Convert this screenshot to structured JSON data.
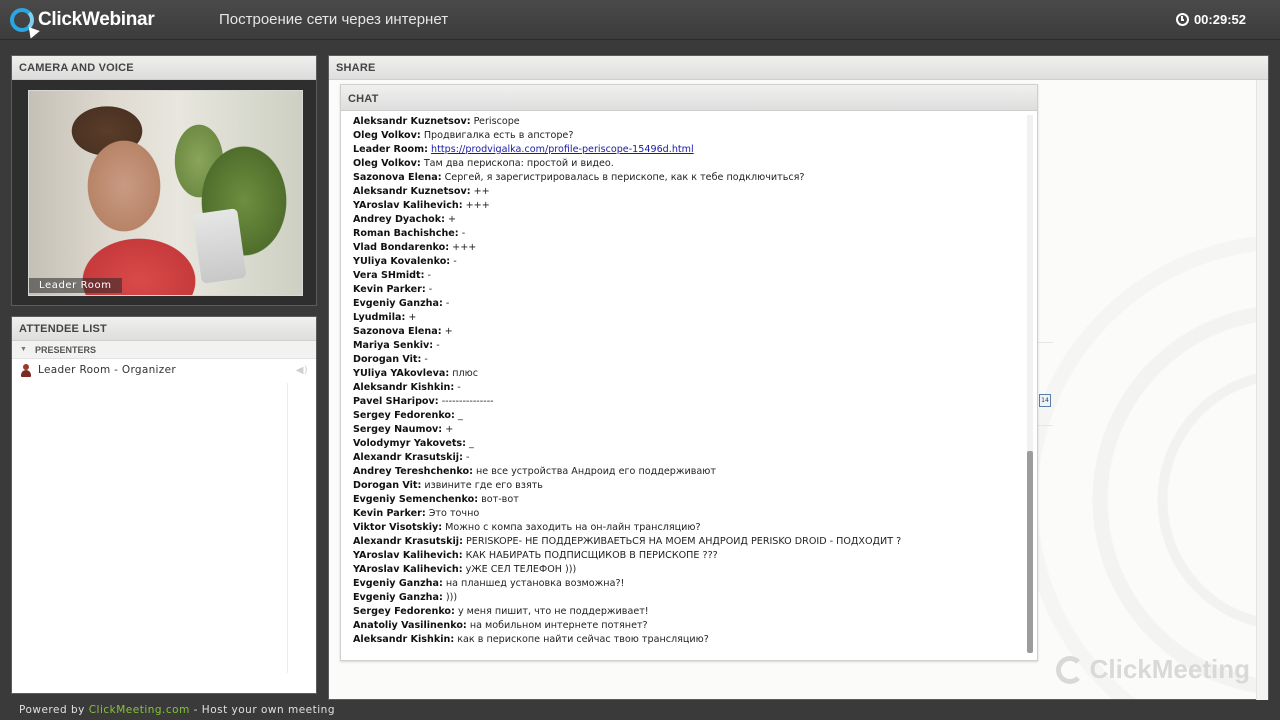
{
  "app": {
    "logo_text": "ClickWebinar",
    "meeting_title": "Построение сети через интернет",
    "timer": "00:29:52",
    "accent_color": "#2aa6e0"
  },
  "camera": {
    "header": "CAMERA AND VOICE",
    "video_label": "Leader Room"
  },
  "attendees": {
    "header": "ATTENDEE LIST",
    "group_label": "PRESENTERS",
    "items": [
      {
        "label": "Leader Room - Organizer"
      }
    ]
  },
  "share": {
    "header": "SHARE",
    "watermark": "ClickMeeting"
  },
  "chat": {
    "header": "CHAT",
    "messages": [
      {
        "author": "Aleksandr Kuznetsov:",
        "text": "Periscope"
      },
      {
        "author": "Oleg Volkov:",
        "text": "Продвигалка есть в апсторе?"
      },
      {
        "author": "Leader Room:",
        "text": "",
        "link": "https://prodvigalka.com/profile-periscope-15496d.html"
      },
      {
        "author": "Oleg Volkov:",
        "text": "Там два перископа: простой и видео."
      },
      {
        "author": "Sazonova Elena:",
        "text": "Сергей, я зарегистрировалась в перископе, как к тебе подключиться?"
      },
      {
        "author": "Aleksandr Kuznetsov:",
        "text": "++"
      },
      {
        "author": "YAroslav Kalihevich:",
        "text": "+++"
      },
      {
        "author": "Andrey Dyachok:",
        "text": "+"
      },
      {
        "author": "Roman Bachishche:",
        "text": "-"
      },
      {
        "author": "Vlad Bondarenko:",
        "text": "+++"
      },
      {
        "author": "YUliya Kovalenko:",
        "text": "-"
      },
      {
        "author": "Vera SHmidt:",
        "text": "-"
      },
      {
        "author": "Kevin Parker:",
        "text": "-"
      },
      {
        "author": "Evgeniy Ganzha:",
        "text": "-"
      },
      {
        "author": "Lyudmila:",
        "text": "+"
      },
      {
        "author": "Sazonova Elena:",
        "text": "+"
      },
      {
        "author": "Mariya Senkiv:",
        "text": "-"
      },
      {
        "author": "Dorogan Vit:",
        "text": "-"
      },
      {
        "author": "YUliya YAkovleva:",
        "text": "плюс"
      },
      {
        "author": "Aleksandr Kishkin:",
        "text": "-"
      },
      {
        "author": "Pavel SHaripov:",
        "text": "---------------"
      },
      {
        "author": "Sergey  Fedorenko:",
        "text": "_"
      },
      {
        "author": "Sergey Naumov:",
        "text": "+"
      },
      {
        "author": "Volodymyr Yakovets:",
        "text": "_"
      },
      {
        "author": "Alexandr  Krasutskij:",
        "text": "-"
      },
      {
        "author": "Andrey Tereshchenko:",
        "text": "не все устройства Андроид его поддерживают"
      },
      {
        "author": "Dorogan Vit:",
        "text": "извините где его взять"
      },
      {
        "author": "Evgeniy Semenchenko:",
        "text": "вот-вот"
      },
      {
        "author": "Kevin Parker:",
        "text": "Это точно"
      },
      {
        "author": "Viktor Visotskiy:",
        "text": "Можно с компа заходить на он-лайн трансляцию?"
      },
      {
        "author": "Alexandr  Krasutskij:",
        "text": "PERISKOPE-   НЕ ПОДДЕРЖИВАЕТЬСЯ НА МОЕМ АНДРОИД     PERISKO DROID - ПОДХОДИТ ?"
      },
      {
        "author": "YAroslav Kalihevich:",
        "text": "КАК НАБИРАТЬ ПОДПИСЩИКОВ В ПЕРИСКОПЕ ???"
      },
      {
        "author": "YAroslav Kalihevich:",
        "text": "уЖЕ СЕЛ ТЕЛЕФОН )))"
      },
      {
        "author": "Evgeniy Ganzha:",
        "text": "на планшед установка возможна?!"
      },
      {
        "author": "Evgeniy Ganzha:",
        "text": ")))"
      },
      {
        "author": "Sergey  Fedorenko:",
        "text": "у меня пишит, что не поддерживает!"
      },
      {
        "author": "Anatoliy Vasilinenko:",
        "text": "на мобильном интернете потянет?"
      },
      {
        "author": "Aleksandr Kishkin:",
        "text": "как в перископе найти сейчас твою трансляцию?"
      }
    ]
  },
  "footer": {
    "prefix": "Powered by ",
    "link": "ClickMeeting.com",
    "suffix": " - Host your own meeting",
    "link_color": "#86c43a"
  }
}
